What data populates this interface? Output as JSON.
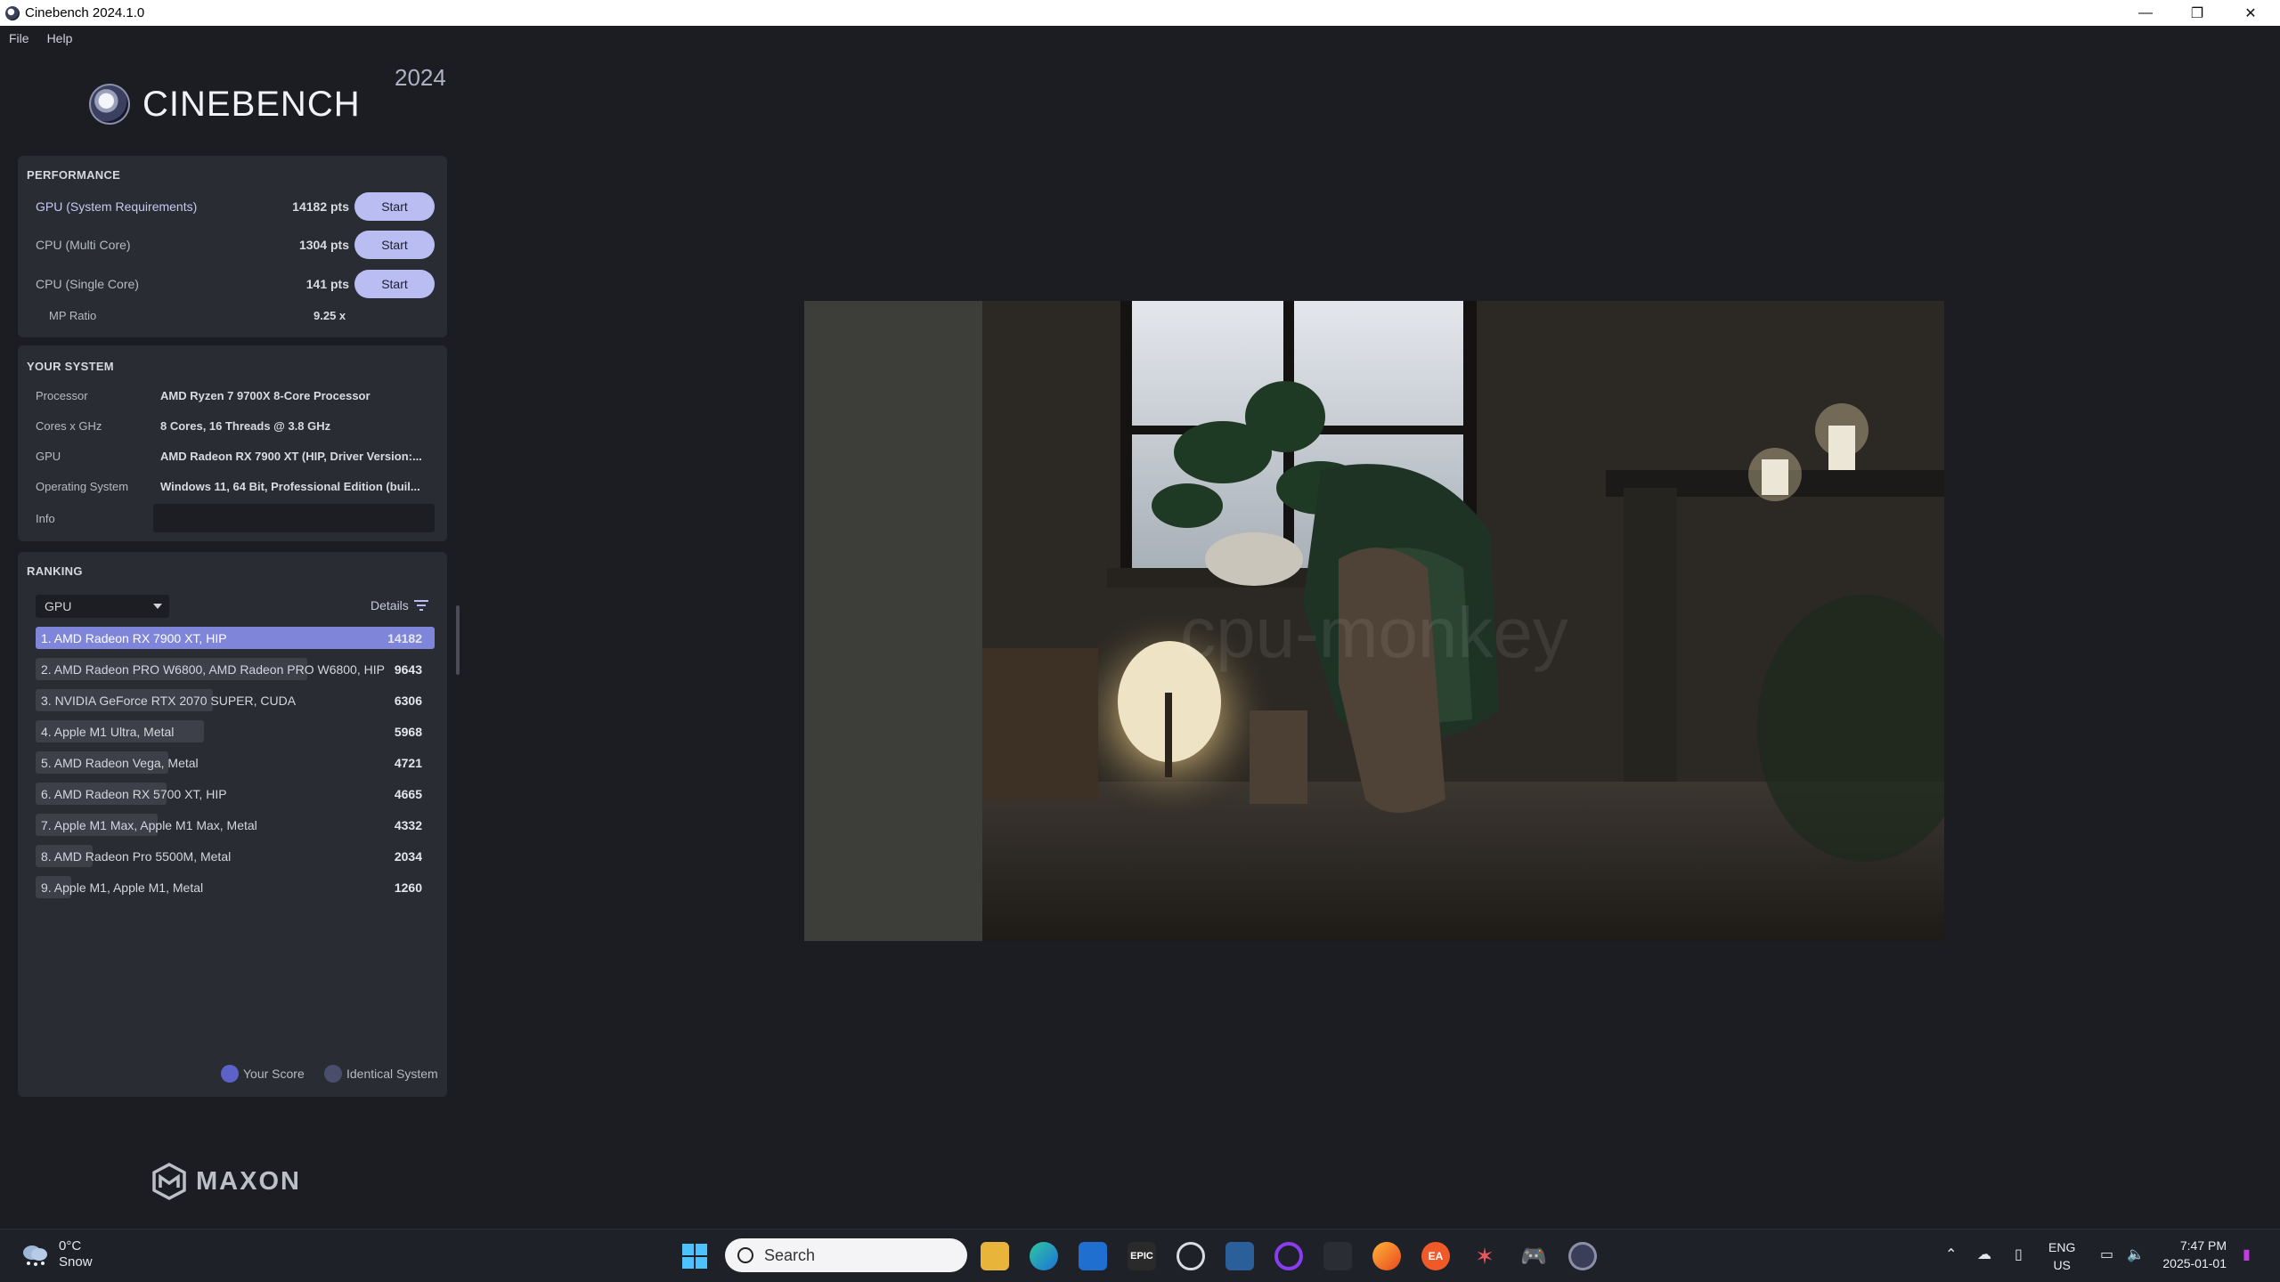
{
  "window": {
    "title": "Cinebench 2024.1.0",
    "minimize": "—",
    "maximize": "❐",
    "close": "✕"
  },
  "menu": {
    "file": "File",
    "help": "Help"
  },
  "logo": {
    "name": "CINEBENCH",
    "year": "2024"
  },
  "performance": {
    "title": "PERFORMANCE",
    "rows": [
      {
        "label": "GPU (System Requirements)",
        "value": "14182 pts",
        "button": "Start"
      },
      {
        "label": "CPU (Multi Core)",
        "value": "1304 pts",
        "button": "Start"
      },
      {
        "label": "CPU (Single Core)",
        "value": "141 pts",
        "button": "Start"
      }
    ],
    "mp_ratio_label": "MP Ratio",
    "mp_ratio_value": "9.25 x"
  },
  "system": {
    "title": "YOUR SYSTEM",
    "rows": [
      {
        "label": "Processor",
        "value": "AMD Ryzen 7 9700X 8-Core Processor"
      },
      {
        "label": "Cores x GHz",
        "value": "8 Cores, 16 Threads @ 3.8 GHz"
      },
      {
        "label": "GPU",
        "value": "AMD Radeon RX 7900 XT (HIP, Driver Version:..."
      },
      {
        "label": "Operating System",
        "value": "Windows 11, 64 Bit, Professional Edition (buil..."
      },
      {
        "label": "Info",
        "value": ""
      }
    ]
  },
  "ranking": {
    "title": "RANKING",
    "dropdown_value": "GPU",
    "details_label": "Details",
    "items": [
      {
        "name": "1. AMD Radeon RX 7900 XT, HIP",
        "score": "14182",
        "fraction": 1.0
      },
      {
        "name": "2. AMD Radeon PRO W6800, AMD Radeon PRO W6800, HIP",
        "score": "9643",
        "fraction": 0.68
      },
      {
        "name": "3. NVIDIA GeForce RTX 2070 SUPER, CUDA",
        "score": "6306",
        "fraction": 0.445
      },
      {
        "name": "4. Apple M1 Ultra, Metal",
        "score": "5968",
        "fraction": 0.421
      },
      {
        "name": "5. AMD Radeon Vega, Metal",
        "score": "4721",
        "fraction": 0.333
      },
      {
        "name": "6. AMD Radeon RX 5700 XT, HIP",
        "score": "4665",
        "fraction": 0.329
      },
      {
        "name": "7. Apple M1 Max, Apple M1 Max, Metal",
        "score": "4332",
        "fraction": 0.305
      },
      {
        "name": "8. AMD Radeon Pro 5500M, Metal",
        "score": "2034",
        "fraction": 0.143
      },
      {
        "name": "9. Apple M1, Apple M1, Metal",
        "score": "1260",
        "fraction": 0.089
      }
    ],
    "legend_your_score": "Your Score",
    "legend_identical": "Identical System",
    "colors": {
      "your_score": "#5c62c8",
      "identical": "#4a4e6a",
      "active_bar": "#7f85d8"
    }
  },
  "brand": {
    "maxon": "MAXON"
  },
  "render": {
    "watermark": "cpu-monkey"
  },
  "taskbar": {
    "weather_temp": "0°C",
    "weather_desc": "Snow",
    "search_placeholder": "Search",
    "lang_top": "ENG",
    "lang_bottom": "US",
    "time": "7:47 PM",
    "date": "2025-01-01",
    "epic_label": "EPIC",
    "ea_label": "EA"
  }
}
